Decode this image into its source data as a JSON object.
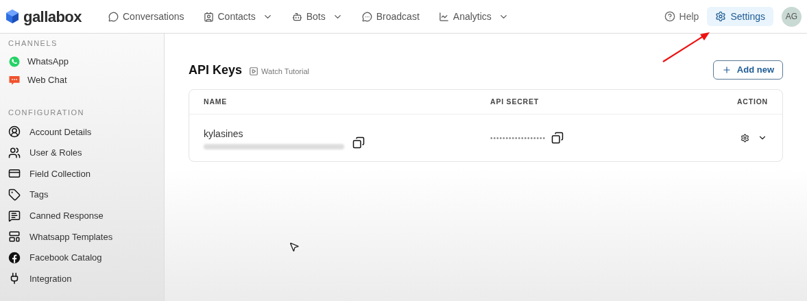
{
  "brand": {
    "name": "gallabox"
  },
  "nav": [
    {
      "label": "Conversations",
      "dropdown": false
    },
    {
      "label": "Contacts",
      "dropdown": true
    },
    {
      "label": "Bots",
      "dropdown": true
    },
    {
      "label": "Broadcast",
      "dropdown": false
    },
    {
      "label": "Analytics",
      "dropdown": true
    }
  ],
  "header_right": {
    "help": "Help",
    "settings": {
      "label": "Settings",
      "selected": true
    },
    "avatar": "AG"
  },
  "sidebar": [
    {
      "heading": "CHANNELS",
      "items": [
        {
          "label": "WhatsApp"
        },
        {
          "label": "Web Chat"
        }
      ]
    },
    {
      "heading": "CONFIGURATION",
      "items": [
        {
          "label": "Account Details"
        },
        {
          "label": "User & Roles"
        },
        {
          "label": "Field Collection"
        },
        {
          "label": "Tags"
        },
        {
          "label": "Canned Response"
        },
        {
          "label": "Whatsapp Templates"
        },
        {
          "label": "Facebook Catalog"
        },
        {
          "label": "Integration"
        }
      ]
    }
  ],
  "page": {
    "title": "API Keys",
    "tutorial": "Watch Tutorial",
    "add_button": "Add new"
  },
  "table": {
    "columns": [
      "NAME",
      "API SECRET",
      "ACTION"
    ],
    "rows": [
      {
        "name": "kylasines",
        "secret": "••••••••••••••••••"
      }
    ]
  }
}
